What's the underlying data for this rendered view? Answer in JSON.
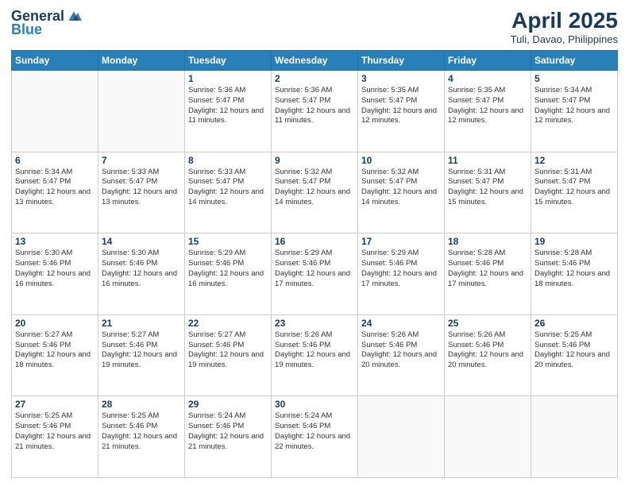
{
  "logo": {
    "general": "General",
    "blue": "Blue"
  },
  "title": "April 2025",
  "subtitle": "Tuli, Davao, Philippines",
  "days_header": [
    "Sunday",
    "Monday",
    "Tuesday",
    "Wednesday",
    "Thursday",
    "Friday",
    "Saturday"
  ],
  "weeks": [
    [
      {
        "day": "",
        "info": ""
      },
      {
        "day": "",
        "info": ""
      },
      {
        "day": "1",
        "info": "Sunrise: 5:36 AM\nSunset: 5:47 PM\nDaylight: 12 hours and 11 minutes."
      },
      {
        "day": "2",
        "info": "Sunrise: 5:36 AM\nSunset: 5:47 PM\nDaylight: 12 hours and 11 minutes."
      },
      {
        "day": "3",
        "info": "Sunrise: 5:35 AM\nSunset: 5:47 PM\nDaylight: 12 hours and 12 minutes."
      },
      {
        "day": "4",
        "info": "Sunrise: 5:35 AM\nSunset: 5:47 PM\nDaylight: 12 hours and 12 minutes."
      },
      {
        "day": "5",
        "info": "Sunrise: 5:34 AM\nSunset: 5:47 PM\nDaylight: 12 hours and 12 minutes."
      }
    ],
    [
      {
        "day": "6",
        "info": "Sunrise: 5:34 AM\nSunset: 5:47 PM\nDaylight: 12 hours and 13 minutes."
      },
      {
        "day": "7",
        "info": "Sunrise: 5:33 AM\nSunset: 5:47 PM\nDaylight: 12 hours and 13 minutes."
      },
      {
        "day": "8",
        "info": "Sunrise: 5:33 AM\nSunset: 5:47 PM\nDaylight: 12 hours and 14 minutes."
      },
      {
        "day": "9",
        "info": "Sunrise: 5:32 AM\nSunset: 5:47 PM\nDaylight: 12 hours and 14 minutes."
      },
      {
        "day": "10",
        "info": "Sunrise: 5:32 AM\nSunset: 5:47 PM\nDaylight: 12 hours and 14 minutes."
      },
      {
        "day": "11",
        "info": "Sunrise: 5:31 AM\nSunset: 5:47 PM\nDaylight: 12 hours and 15 minutes."
      },
      {
        "day": "12",
        "info": "Sunrise: 5:31 AM\nSunset: 5:47 PM\nDaylight: 12 hours and 15 minutes."
      }
    ],
    [
      {
        "day": "13",
        "info": "Sunrise: 5:30 AM\nSunset: 5:46 PM\nDaylight: 12 hours and 16 minutes."
      },
      {
        "day": "14",
        "info": "Sunrise: 5:30 AM\nSunset: 5:46 PM\nDaylight: 12 hours and 16 minutes."
      },
      {
        "day": "15",
        "info": "Sunrise: 5:29 AM\nSunset: 5:46 PM\nDaylight: 12 hours and 16 minutes."
      },
      {
        "day": "16",
        "info": "Sunrise: 5:29 AM\nSunset: 5:46 PM\nDaylight: 12 hours and 17 minutes."
      },
      {
        "day": "17",
        "info": "Sunrise: 5:29 AM\nSunset: 5:46 PM\nDaylight: 12 hours and 17 minutes."
      },
      {
        "day": "18",
        "info": "Sunrise: 5:28 AM\nSunset: 5:46 PM\nDaylight: 12 hours and 17 minutes."
      },
      {
        "day": "19",
        "info": "Sunrise: 5:28 AM\nSunset: 5:46 PM\nDaylight: 12 hours and 18 minutes."
      }
    ],
    [
      {
        "day": "20",
        "info": "Sunrise: 5:27 AM\nSunset: 5:46 PM\nDaylight: 12 hours and 18 minutes."
      },
      {
        "day": "21",
        "info": "Sunrise: 5:27 AM\nSunset: 5:46 PM\nDaylight: 12 hours and 19 minutes."
      },
      {
        "day": "22",
        "info": "Sunrise: 5:27 AM\nSunset: 5:46 PM\nDaylight: 12 hours and 19 minutes."
      },
      {
        "day": "23",
        "info": "Sunrise: 5:26 AM\nSunset: 5:46 PM\nDaylight: 12 hours and 19 minutes."
      },
      {
        "day": "24",
        "info": "Sunrise: 5:26 AM\nSunset: 5:46 PM\nDaylight: 12 hours and 20 minutes."
      },
      {
        "day": "25",
        "info": "Sunrise: 5:26 AM\nSunset: 5:46 PM\nDaylight: 12 hours and 20 minutes."
      },
      {
        "day": "26",
        "info": "Sunrise: 5:25 AM\nSunset: 5:46 PM\nDaylight: 12 hours and 20 minutes."
      }
    ],
    [
      {
        "day": "27",
        "info": "Sunrise: 5:25 AM\nSunset: 5:46 PM\nDaylight: 12 hours and 21 minutes."
      },
      {
        "day": "28",
        "info": "Sunrise: 5:25 AM\nSunset: 5:46 PM\nDaylight: 12 hours and 21 minutes."
      },
      {
        "day": "29",
        "info": "Sunrise: 5:24 AM\nSunset: 5:46 PM\nDaylight: 12 hours and 21 minutes."
      },
      {
        "day": "30",
        "info": "Sunrise: 5:24 AM\nSunset: 5:46 PM\nDaylight: 12 hours and 22 minutes."
      },
      {
        "day": "",
        "info": ""
      },
      {
        "day": "",
        "info": ""
      },
      {
        "day": "",
        "info": ""
      }
    ]
  ]
}
